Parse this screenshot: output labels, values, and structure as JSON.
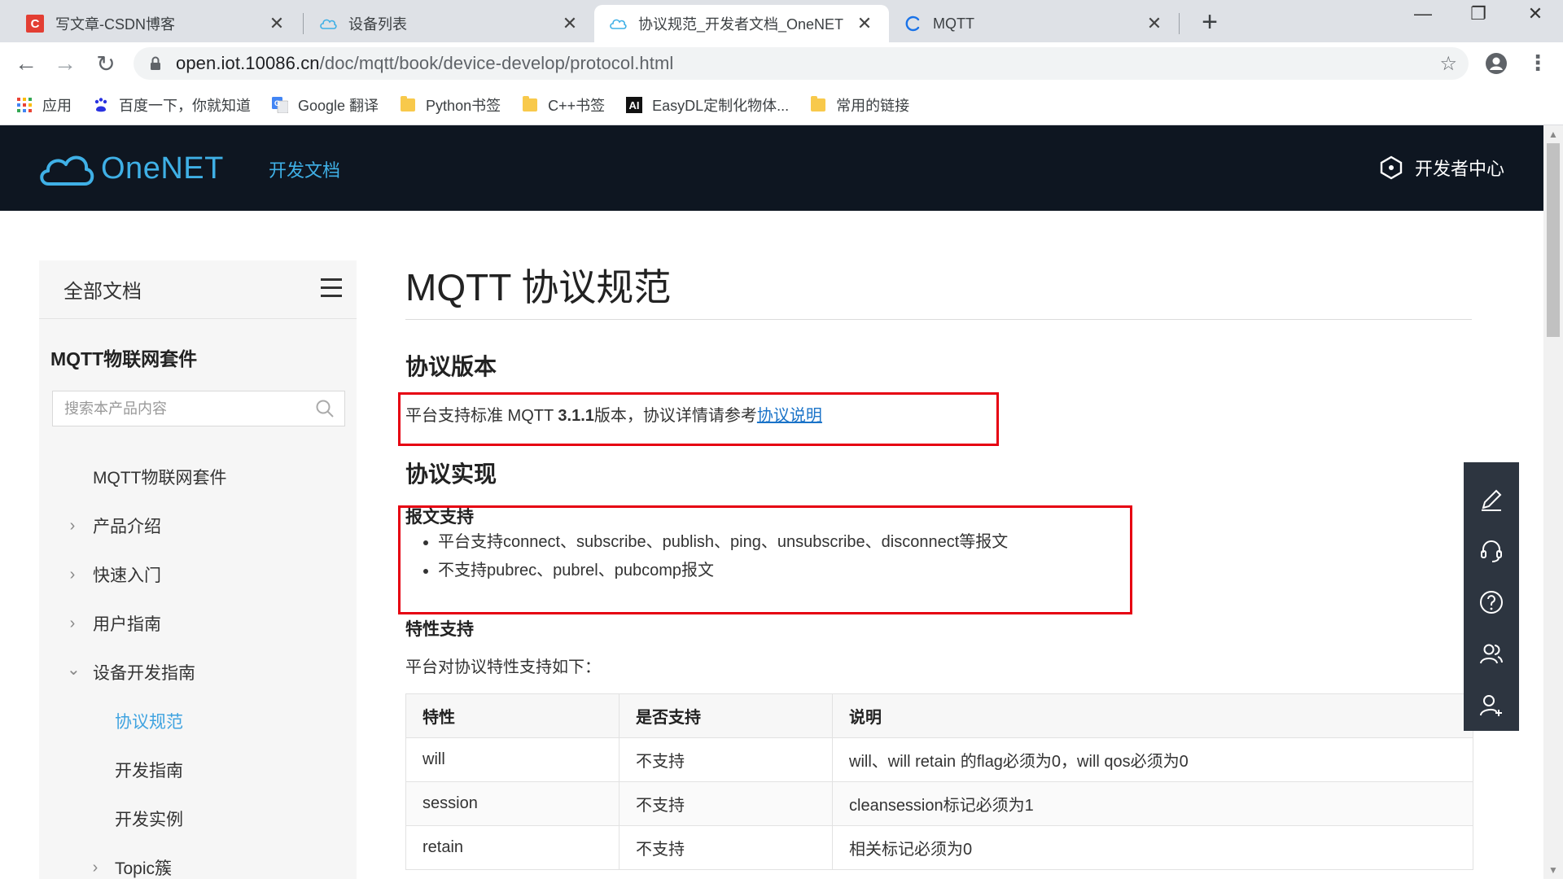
{
  "tabs": [
    {
      "title": "写文章-CSDN博客",
      "favicon": "csdn-icon"
    },
    {
      "title": "设备列表",
      "favicon": "cloud-icon"
    },
    {
      "title": "协议规范_开发者文档_OneNET",
      "favicon": "cloud-icon"
    },
    {
      "title": "MQTT",
      "favicon": "loading-icon"
    }
  ],
  "toolbar": {
    "url_host": "open.iot.10086.cn",
    "url_path": "/doc/mqtt/book/device-develop/protocol.html"
  },
  "bookmarks": [
    {
      "label": "应用",
      "icon": "apps-grid-icon"
    },
    {
      "label": "百度一下，你就知道",
      "icon": "baidu-paw-icon"
    },
    {
      "label": "Google 翻译",
      "icon": "google-translate-icon"
    },
    {
      "label": "Python书签",
      "icon": "folder-icon"
    },
    {
      "label": "C++书签",
      "icon": "folder-icon"
    },
    {
      "label": "EasyDL定制化物体...",
      "icon": "ai-icon"
    },
    {
      "label": "常用的链接",
      "icon": "folder-icon"
    }
  ],
  "header": {
    "logo": "OneNET",
    "nav_docs": "开发文档",
    "dev_center": "开发者中心"
  },
  "sidebar": {
    "heading": "全部文档",
    "product": "MQTT物联网套件",
    "search_placeholder": "搜索本产品内容",
    "items": [
      {
        "label": "MQTT物联网套件",
        "arrow": ""
      },
      {
        "label": "产品介绍",
        "arrow": "›"
      },
      {
        "label": "快速入门",
        "arrow": "›"
      },
      {
        "label": "用户指南",
        "arrow": "›"
      },
      {
        "label": "设备开发指南",
        "arrow": "⌄"
      },
      {
        "label": "协议规范",
        "arrow": ""
      },
      {
        "label": "开发指南",
        "arrow": ""
      },
      {
        "label": "开发实例",
        "arrow": ""
      },
      {
        "label": "Topic簇",
        "arrow": "›"
      }
    ]
  },
  "main": {
    "title": "MQTT 协议规范",
    "section_version": "协议版本",
    "version_text_pre": "平台支持标准 MQTT ",
    "version_number": "3.1.1",
    "version_text_mid": "版本，协议详情请参考",
    "version_link": "协议说明",
    "section_impl": "协议实现",
    "packet_support": "报文支持",
    "packet_bullets": [
      "平台支持connect、subscribe、publish、ping、unsubscribe、disconnect等报文",
      "不支持pubrec、pubrel、pubcomp报文"
    ],
    "feature_support": "特性支持",
    "feature_intro": "平台对协议特性支持如下：",
    "table_headers": [
      "特性",
      "是否支持",
      "说明"
    ],
    "table_rows": [
      [
        "will",
        "不支持",
        "will、will retain 的flag必须为0，will qos必须为0"
      ],
      [
        "session",
        "不支持",
        "cleansession标记必须为1"
      ],
      [
        "retain",
        "不支持",
        "相关标记必须为0"
      ]
    ]
  },
  "colors": {
    "accent": "#3fb0e6",
    "header_bg": "#0e1621",
    "highlight_box": "#e60012",
    "link": "#1a73c8",
    "fab_bg": "#2d3540"
  }
}
